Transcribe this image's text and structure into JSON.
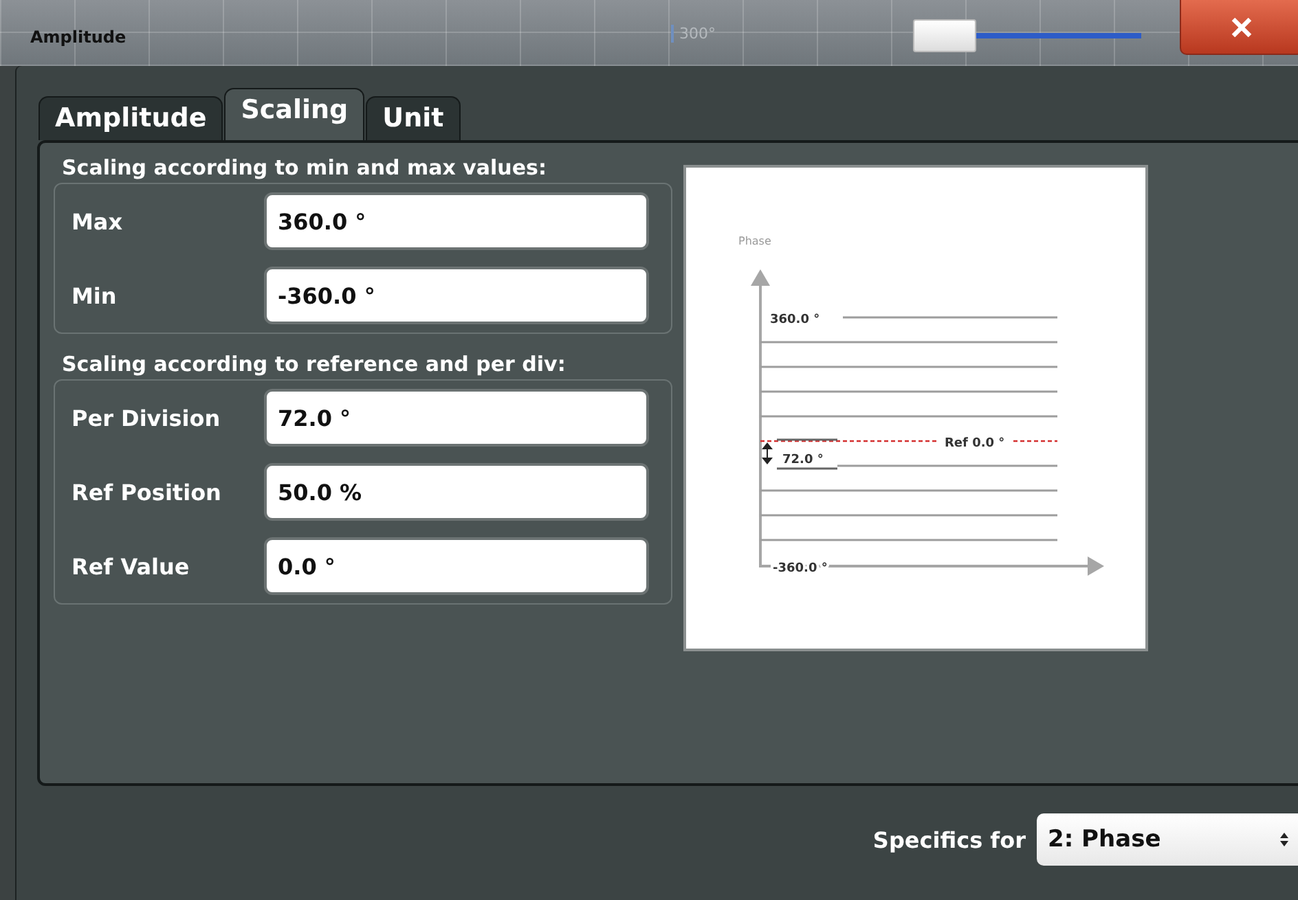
{
  "window": {
    "title": "Amplitude"
  },
  "backdrop": {
    "axis_label": "300°"
  },
  "slider": {
    "level": 0
  },
  "tabs": [
    {
      "label": "Amplitude",
      "selected": false
    },
    {
      "label": "Scaling",
      "selected": true
    },
    {
      "label": "Unit",
      "selected": false
    }
  ],
  "groups": [
    {
      "heading": "Scaling according to min and max values:",
      "fields": [
        {
          "label": "Max",
          "value": "360.0 °"
        },
        {
          "label": "Min",
          "value": "-360.0 °"
        }
      ]
    },
    {
      "heading": "Scaling according to reference and per div:",
      "fields": [
        {
          "label": "Per Division",
          "value": "72.0 °"
        },
        {
          "label": "Ref Position",
          "value": "50.0 %"
        },
        {
          "label": "Ref Value",
          "value": "0.0 °"
        }
      ]
    }
  ],
  "diagram": {
    "axis_label": "Phase",
    "top_label": "360.0 °",
    "bottom_label": "-360.0 °",
    "ref_label": "Ref 0.0 °",
    "division_label": "72.0 °"
  },
  "footer": {
    "label": "Specifics for",
    "dropdown_value": "2: Phase"
  }
}
